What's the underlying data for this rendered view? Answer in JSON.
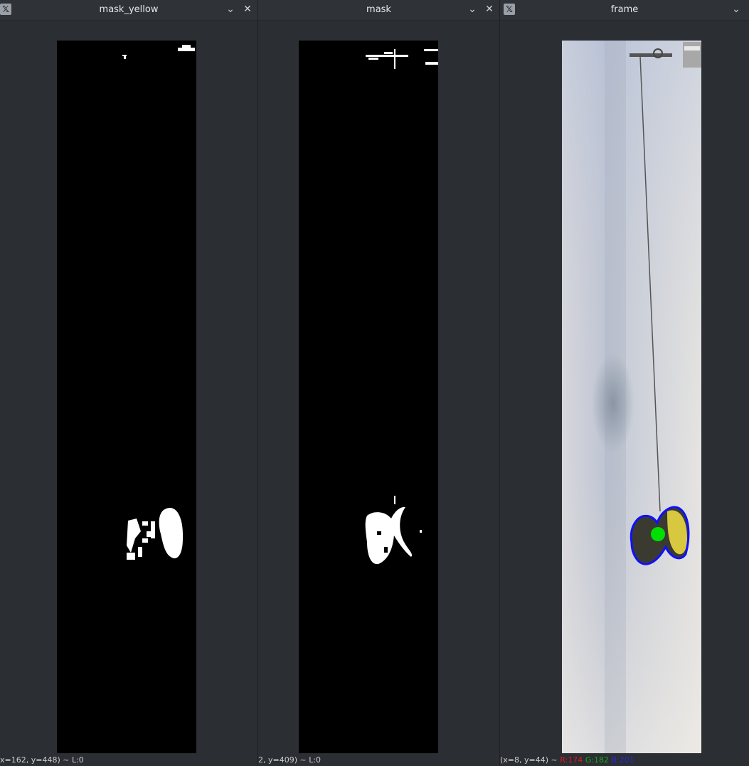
{
  "windows": [
    {
      "title": "mask_yellow",
      "status": "x=162, y=448) ~ L:0",
      "has_close": true
    },
    {
      "title": "mask",
      "status": "2, y=409) ~ L:0",
      "has_close": true
    },
    {
      "title": "frame",
      "status_prefix": "(x=8, y=44) ~ ",
      "status_r": "R:174",
      "status_g": "G:182",
      "status_b": "B:201",
      "has_close": false
    }
  ],
  "icons": {
    "app": "x11-app-icon",
    "menu": "chevron-down-icon",
    "close": "close-icon"
  },
  "colors": {
    "background": "#2b2e33",
    "contour": "#1010ff",
    "centroid": "#00e000",
    "status_red": "#e01c1c",
    "status_green": "#1ca81c",
    "status_blue": "#2a2ae0"
  }
}
